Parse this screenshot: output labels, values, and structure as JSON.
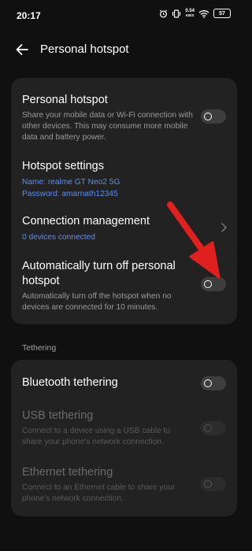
{
  "status": {
    "time": "20:17",
    "net_speed_value": "0.54",
    "net_speed_unit": "KB/S",
    "battery": "57",
    "icons": [
      "alarm-icon",
      "vibrate-icon",
      "wifi-icon",
      "battery-icon"
    ]
  },
  "header": {
    "title": "Personal hotspot",
    "back_icon": "arrow-left-icon"
  },
  "hotspot": {
    "title": "Personal hotspot",
    "description": "Share your mobile data or Wi-Fi connection with other devices. This may consume more mobile data and battery power.",
    "enabled": false
  },
  "hotspot_settings": {
    "title": "Hotspot settings",
    "name_line": "Name: realme GT Neo2 5G",
    "password_line": "Password: amarnath12345"
  },
  "connection_management": {
    "title": "Connection management",
    "devices": "0 devices connected",
    "chevron_icon": "chevron-right-icon"
  },
  "auto_off": {
    "title_line1": "Automatically turn off personal",
    "title_line2": "hotspot",
    "description": "Automatically turn off the hotspot when no devices are connected for 10 minutes.",
    "enabled": false
  },
  "tethering": {
    "section_label": "Tethering",
    "bluetooth": {
      "title": "Bluetooth tethering",
      "enabled": false
    },
    "usb": {
      "title": "USB tethering",
      "description": "Connect to a device using a USB cable to share your phone's network connection.",
      "enabled": false,
      "disabled": true
    },
    "ethernet": {
      "title": "Ethernet tethering",
      "description": "Connect to an Ethernet cable to share your phone's network connection.",
      "enabled": false,
      "disabled": true
    }
  },
  "colors": {
    "background": "#101010",
    "card": "#222222",
    "accent_blue": "#5b8df0",
    "annotation_red": "#e0201f"
  }
}
